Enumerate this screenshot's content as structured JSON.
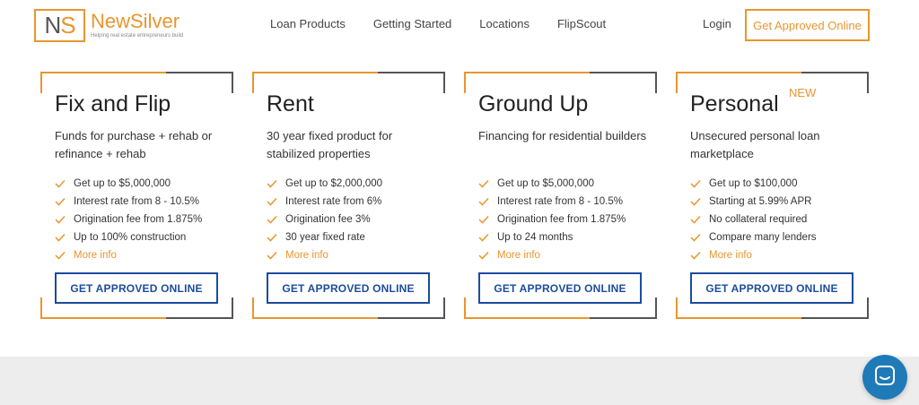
{
  "brand": {
    "logo_letters_n": "N",
    "logo_letters_s": "S",
    "name": "NewSilver",
    "tagline": "Helping real estate entrepreneurs build",
    "accent_color": "#e8962e",
    "button_color": "#1c4c9c"
  },
  "nav": {
    "items": [
      "Loan Products",
      "Getting Started",
      "Locations",
      "FlipScout"
    ],
    "login": "Login",
    "cta": "Get Approved Online"
  },
  "cards": [
    {
      "title": "Fix and Flip",
      "badge": "",
      "desc": "Funds for purchase + rehab or refinance + rehab",
      "features": [
        "Get up to $5,000,000",
        "Interest rate from 8 - 10.5%",
        "Origination fee from 1.875%",
        "Up to 100% construction"
      ],
      "more": "More info",
      "button": "GET APPROVED ONLINE"
    },
    {
      "title": "Rent",
      "badge": "",
      "desc": "30 year fixed product for stabilized properties",
      "features": [
        "Get up to $2,000,000",
        "Interest rate from 6%",
        "Origination fee 3%",
        "30 year fixed rate"
      ],
      "more": "More info",
      "button": "GET APPROVED ONLINE"
    },
    {
      "title": "Ground Up",
      "badge": "",
      "desc": "Financing for residential builders",
      "features": [
        "Get up to $5,000,000",
        "Interest rate from 8 - 10.5%",
        "Origination fee from 1.875%",
        "Up to 24 months"
      ],
      "more": "More info",
      "button": "GET APPROVED ONLINE"
    },
    {
      "title": "Personal",
      "badge": "NEW",
      "desc": "Unsecured personal loan marketplace",
      "features": [
        "Get up to $100,000",
        "Starting at 5.99% APR",
        "No collateral required",
        "Compare many lenders"
      ],
      "more": "More info",
      "button": "GET APPROVED ONLINE"
    }
  ],
  "chat": {
    "icon": "chat-icon"
  }
}
